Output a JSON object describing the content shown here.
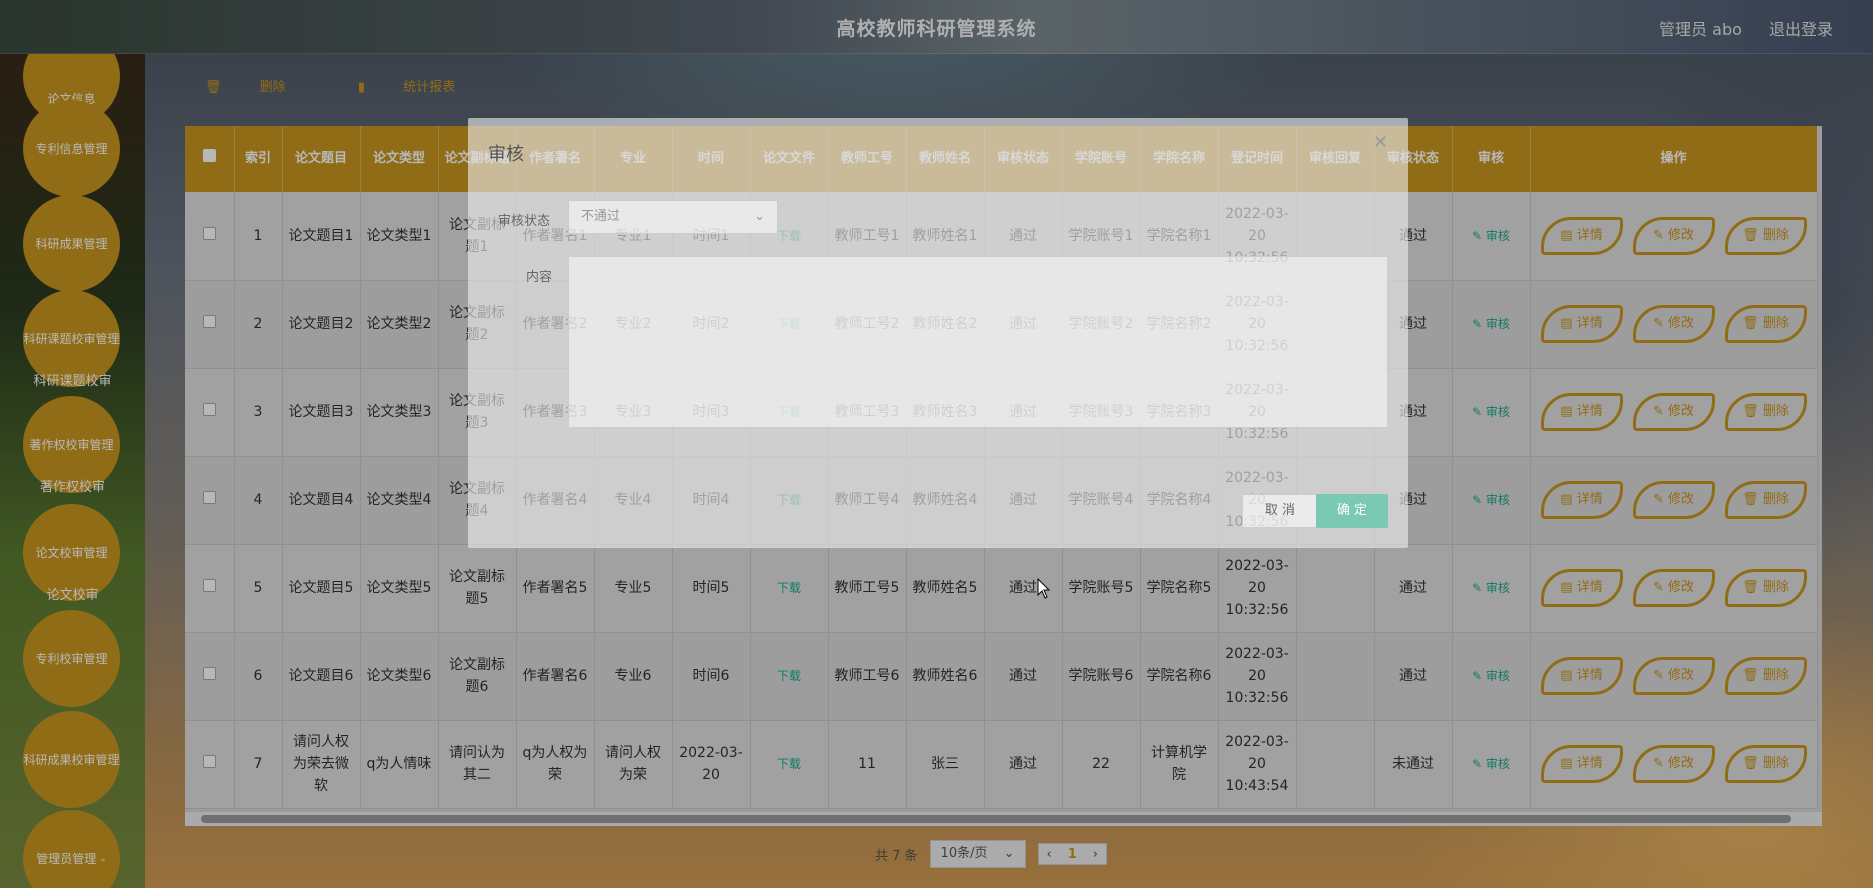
{
  "header": {
    "title": "高校教师科研管理系统",
    "user_label": "管理员 abo",
    "logout_label": "退出登录"
  },
  "sidebar": {
    "items": [
      {
        "label": "论文信息"
      },
      {
        "label": "专利信息管理"
      },
      {
        "label": "科研成果管理"
      },
      {
        "label": "科研课题校审管理"
      },
      {
        "label": "著作权校审管理"
      },
      {
        "label": "论文校审管理"
      },
      {
        "label": "专利校审管理"
      },
      {
        "label": "科研成果校审管理"
      },
      {
        "label": "管理员管理"
      }
    ],
    "subtexts": [
      "科研课题校审",
      "著作权校审",
      "论文校审"
    ]
  },
  "toolbar": {
    "delete_label": "删除",
    "report_label": "统计报表"
  },
  "table": {
    "headers": [
      "索引",
      "论文题目",
      "论文类型",
      "论文副标题",
      "作者署名",
      "专业",
      "时间",
      "论文文件",
      "教师工号",
      "教师姓名",
      "审核状态",
      "学院账号",
      "学院名称",
      "登记时间",
      "审核回复",
      "审核状态",
      "审核",
      "操作"
    ],
    "download_label": "下载",
    "audit_label": "审核",
    "detail_label": "详情",
    "edit_label": "修改",
    "delete_label": "删除",
    "rows": [
      {
        "idx": "1",
        "title": "论文题目1",
        "type": "论文类型1",
        "subtitle": "论文副标题1",
        "author": "作者署名1",
        "major": "专业1",
        "time": "时间1",
        "tno": "教师工号1",
        "tname": "教师姓名1",
        "status": "通过",
        "acc": "学院账号1",
        "college": "学院名称1",
        "reg": "2022-03-20 10:32:56",
        "reply": "",
        "status2": "通过"
      },
      {
        "idx": "2",
        "title": "论文题目2",
        "type": "论文类型2",
        "subtitle": "论文副标题2",
        "author": "作者署名2",
        "major": "专业2",
        "time": "时间2",
        "tno": "教师工号2",
        "tname": "教师姓名2",
        "status": "通过",
        "acc": "学院账号2",
        "college": "学院名称2",
        "reg": "2022-03-20 10:32:56",
        "reply": "",
        "status2": "通过"
      },
      {
        "idx": "3",
        "title": "论文题目3",
        "type": "论文类型3",
        "subtitle": "论文副标题3",
        "author": "作者署名3",
        "major": "专业3",
        "time": "时间3",
        "tno": "教师工号3",
        "tname": "教师姓名3",
        "status": "通过",
        "acc": "学院账号3",
        "college": "学院名称3",
        "reg": "2022-03-20 10:32:56",
        "reply": "",
        "status2": "通过"
      },
      {
        "idx": "4",
        "title": "论文题目4",
        "type": "论文类型4",
        "subtitle": "论文副标题4",
        "author": "作者署名4",
        "major": "专业4",
        "time": "时间4",
        "tno": "教师工号4",
        "tname": "教师姓名4",
        "status": "通过",
        "acc": "学院账号4",
        "college": "学院名称4",
        "reg": "2022-03-20 10:32:56",
        "reply": "",
        "status2": "通过"
      },
      {
        "idx": "5",
        "title": "论文题目5",
        "type": "论文类型5",
        "subtitle": "论文副标题5",
        "author": "作者署名5",
        "major": "专业5",
        "time": "时间5",
        "tno": "教师工号5",
        "tname": "教师姓名5",
        "status": "通过",
        "acc": "学院账号5",
        "college": "学院名称5",
        "reg": "2022-03-20 10:32:56",
        "reply": "",
        "status2": "通过"
      },
      {
        "idx": "6",
        "title": "论文题目6",
        "type": "论文类型6",
        "subtitle": "论文副标题6",
        "author": "作者署名6",
        "major": "专业6",
        "time": "时间6",
        "tno": "教师工号6",
        "tname": "教师姓名6",
        "status": "通过",
        "acc": "学院账号6",
        "college": "学院名称6",
        "reg": "2022-03-20 10:32:56",
        "reply": "",
        "status2": "通过"
      },
      {
        "idx": "7",
        "title": "请问人权为荣去微软",
        "type": "q为人情味",
        "subtitle": "请问认为其二",
        "author": "q为人权为荣",
        "major": "请问人权为荣",
        "time": "2022-03-20",
        "tno": "11",
        "tname": "张三",
        "status": "通过",
        "acc": "22",
        "college": "计算机学院",
        "reg": "2022-03-20 10:43:54",
        "reply": "",
        "status2": "未通过"
      }
    ]
  },
  "pager": {
    "total_label": "共 7 条",
    "page_size": "10条/页",
    "current_page": "1"
  },
  "dialog": {
    "title": "审核",
    "status_label": "审核状态",
    "status_value": "不通过",
    "content_label": "内容",
    "cancel_label": "取 消",
    "ok_label": "确 定"
  },
  "colors": {
    "accent": "#c9961f",
    "success": "#1aaa8a"
  }
}
